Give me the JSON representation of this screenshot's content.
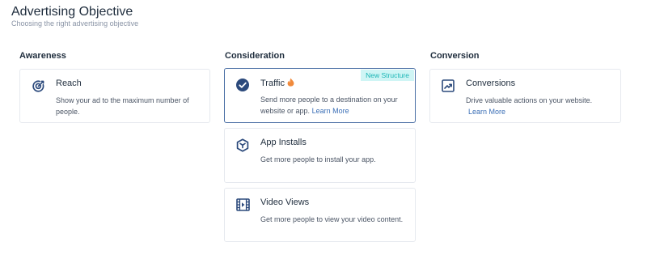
{
  "header": {
    "title": "Advertising Objective",
    "subtitle": "Choosing the right advertising objective"
  },
  "columns": {
    "awareness": "Awareness",
    "consideration": "Consideration",
    "conversion": "Conversion"
  },
  "cards": {
    "reach": {
      "title": "Reach",
      "description": "Show your ad to the maximum number of people."
    },
    "traffic": {
      "title": "Traffic",
      "badge": "New Structure",
      "description": "Send more people to a destination on your website or app.",
      "link": "Learn More",
      "selected": true
    },
    "app_installs": {
      "title": "App Installs",
      "description": "Get more people to install your app."
    },
    "video_views": {
      "title": "Video Views",
      "description": "Get more people to view your video content."
    },
    "conversions": {
      "title": "Conversions",
      "description": "Drive valuable actions on your website.",
      "link": "Learn More"
    }
  },
  "icons": {
    "reach": "target-icon",
    "traffic": "check-circle-icon",
    "traffic_hot": "flame-icon",
    "app_installs": "cube-icon",
    "video_views": "film-icon",
    "conversions": "trend-chart-icon"
  },
  "colors": {
    "accent": "#2c4a7c",
    "link": "#3b6fb6",
    "badge_bg": "#cff5f5",
    "badge_text": "#19b5b5",
    "flame": "#f08a3c"
  }
}
